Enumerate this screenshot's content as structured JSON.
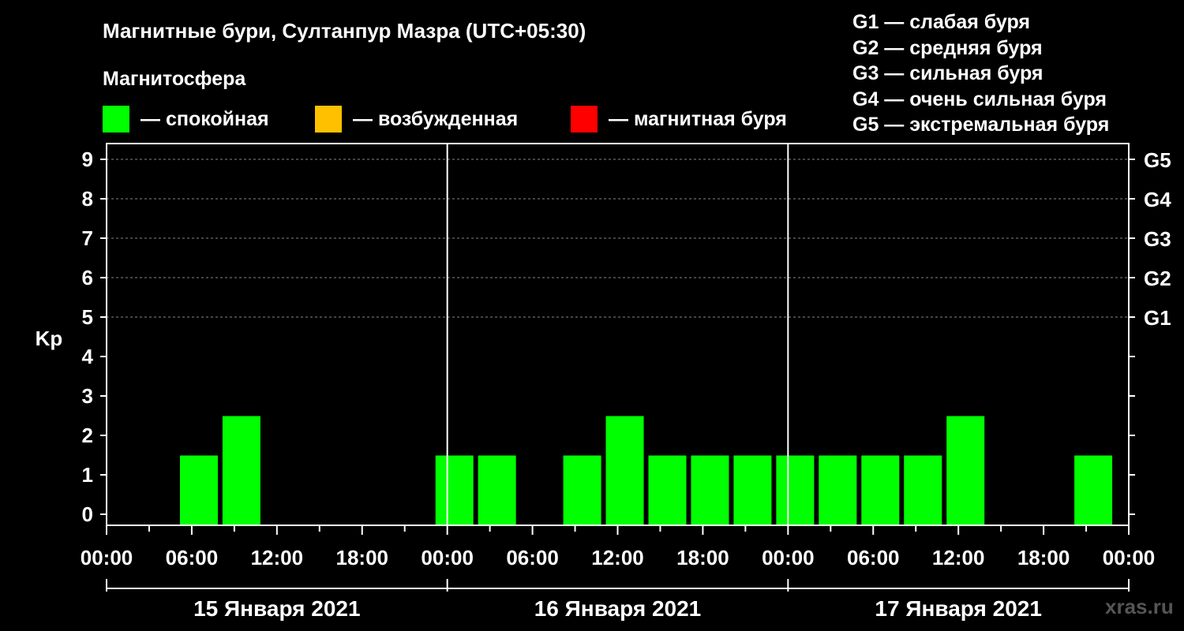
{
  "chart_data": {
    "type": "bar",
    "title": "Магнитные бури, Султанпур Мазра (UTC+05:30)",
    "subtitle": "Магнитосфера",
    "ylabel": "Kp",
    "ylim": [
      0,
      9
    ],
    "y_ticks": [
      "0",
      "1",
      "2",
      "3",
      "4",
      "5",
      "6",
      "7",
      "8",
      "9"
    ],
    "g_ticks": [
      {
        "kp": 5,
        "label": "G1"
      },
      {
        "kp": 6,
        "label": "G2"
      },
      {
        "kp": 7,
        "label": "G3"
      },
      {
        "kp": 8,
        "label": "G4"
      },
      {
        "kp": 9,
        "label": "G5"
      }
    ],
    "x_tick_labels": [
      "00:00",
      "06:00",
      "12:00",
      "18:00",
      "00:00",
      "06:00",
      "12:00",
      "18:00",
      "00:00",
      "06:00",
      "12:00",
      "18:00",
      "00:00"
    ],
    "days": [
      "15 Января 2021",
      "16 Января 2021",
      "17 Января 2021"
    ],
    "bars_start_times": [
      "00:00",
      "03:00",
      "06:00",
      "09:00",
      "12:00",
      "15:00",
      "18:00",
      "21:00"
    ],
    "series": [
      {
        "values": [
          0,
          1,
          2,
          0,
          0,
          0,
          0,
          1,
          1,
          0,
          1,
          2,
          1,
          1,
          1,
          1,
          1,
          1,
          1,
          2,
          0,
          0,
          1,
          0
        ]
      }
    ],
    "legend": [
      {
        "label": "— спокойная",
        "color": "#00ff00"
      },
      {
        "label": "— возбужденная",
        "color": "#ffc000"
      },
      {
        "label": "— магнитная буря",
        "color": "#ff0000"
      }
    ],
    "g_legend": [
      "G1 — слабая буря",
      "G2 — средняя буря",
      "G3 — сильная буря",
      "G4 — очень сильная буря",
      "G5 — экстремальная буря"
    ],
    "grid": true,
    "colors": {
      "quiet": "#00ff00",
      "unsettled": "#ffc000",
      "storm": "#ff0000"
    }
  },
  "watermark": "xras.ru"
}
